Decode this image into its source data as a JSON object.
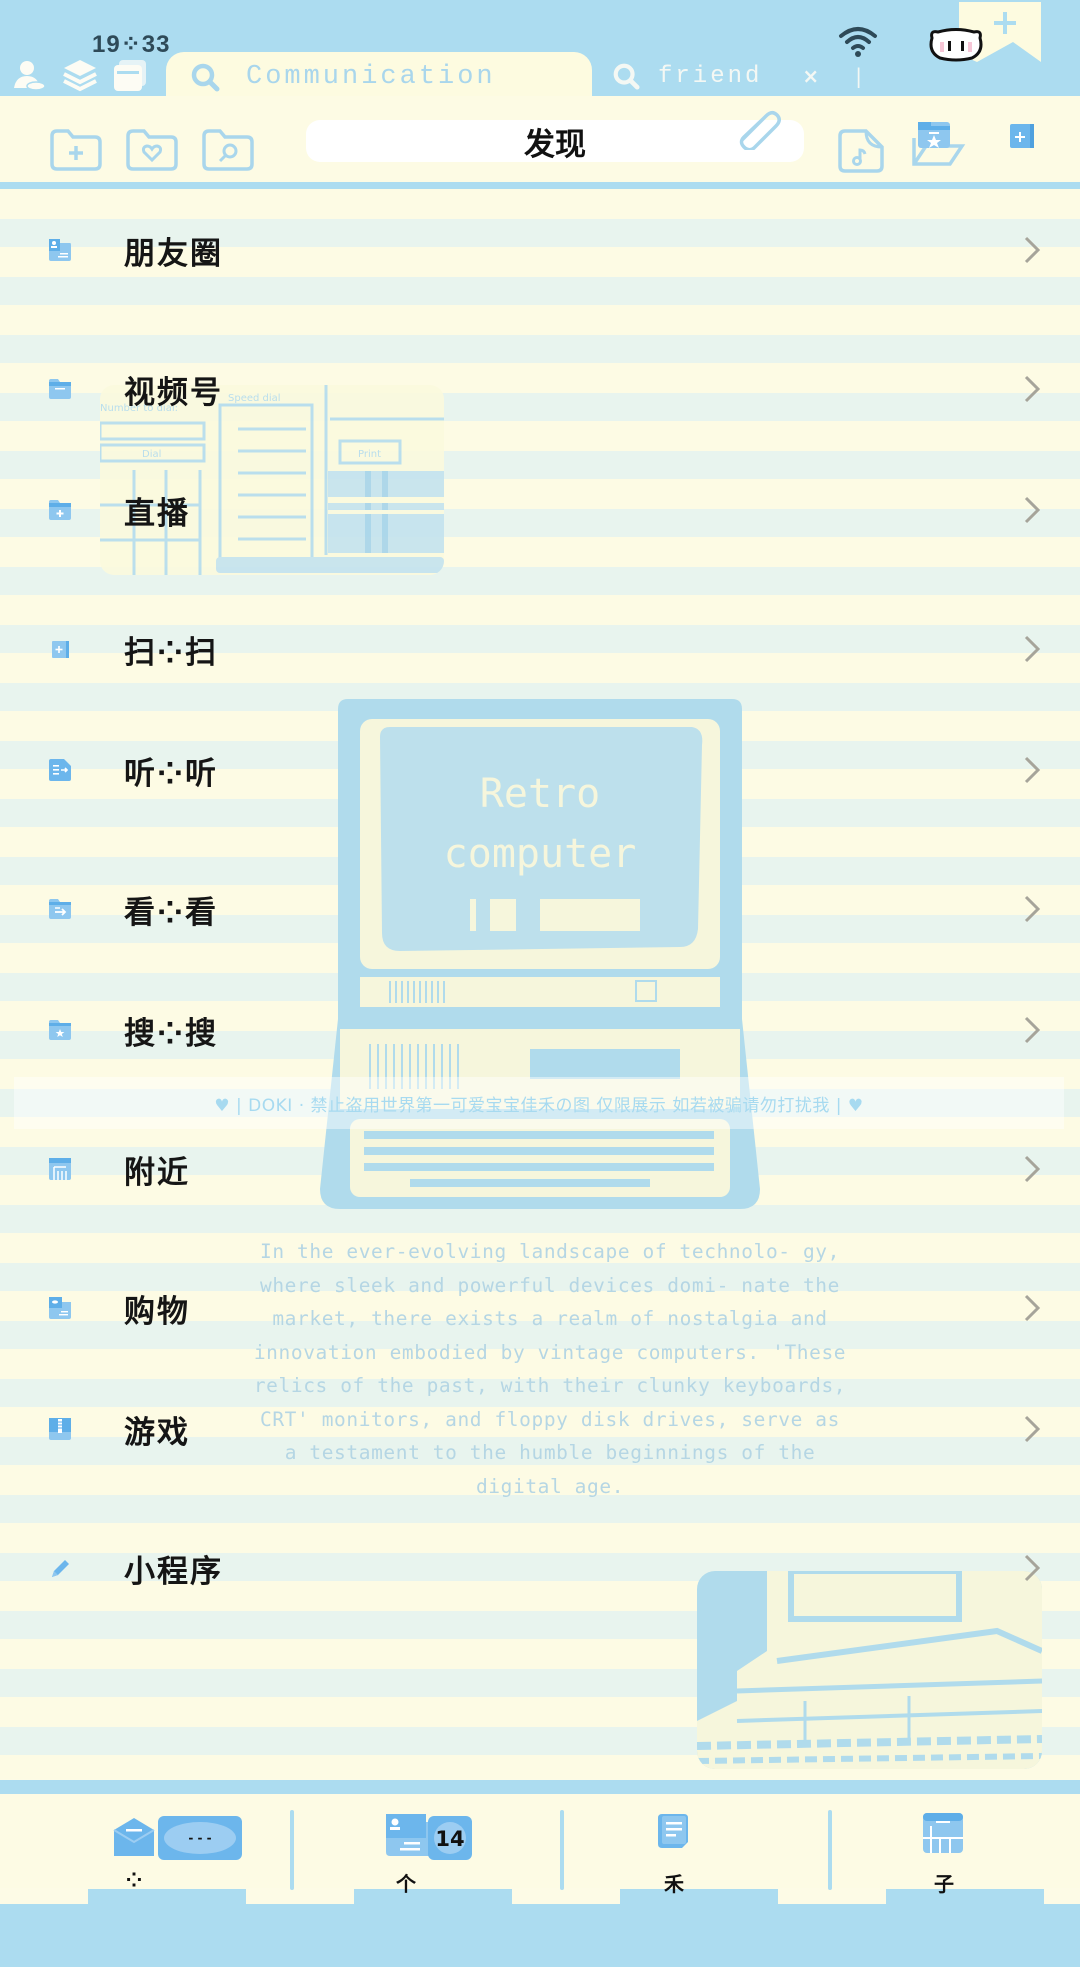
{
  "status_bar": {
    "time": "19⁘33",
    "wifi_icon": "wifi-icon",
    "mascot_icon": "cat-face-icon"
  },
  "tabs": [
    {
      "label": "Communication",
      "active": true,
      "icon": "search-icon"
    },
    {
      "label": "friend",
      "active": false,
      "icon": "search-icon",
      "close": "×",
      "cursor": "|"
    }
  ],
  "toolbar": {
    "title": "发现",
    "left_icons": [
      "folder-add-icon",
      "folder-heart-icon",
      "folder-search-icon"
    ],
    "right_icons": [
      "paperclip-icon",
      "music-file-icon",
      "star-folder-icon",
      "add-square-icon"
    ],
    "new_tab_button": "+"
  },
  "menu": {
    "items": [
      {
        "label": "朋友圈",
        "icon": "contact-folder-icon"
      },
      {
        "label": "视频号",
        "icon": "folder-icon"
      },
      {
        "label": "直播",
        "icon": "folder-plus-icon"
      },
      {
        "label": "扫⁘扫",
        "icon": "square-plus-icon"
      },
      {
        "label": "听⁘听",
        "icon": "document-arrow-icon"
      },
      {
        "label": "看⁘看",
        "icon": "folder-arrow-icon"
      },
      {
        "label": "搜⁘搜",
        "icon": "folder-star-icon"
      },
      {
        "label": "附近",
        "icon": "building-icon"
      },
      {
        "label": "购物",
        "icon": "card-icon"
      },
      {
        "label": "游戏",
        "icon": "zipper-icon"
      },
      {
        "label": "小程序",
        "icon": "pencil-icon"
      }
    ]
  },
  "decor": {
    "screen_text_line1": "Retro",
    "screen_text_line2": "computer",
    "watermark": "♥ | DOKI · 禁止盗用世界第一可爱宝宝佳禾の图 仅限展示 如若被骗请勿打扰我 | ♥",
    "paragraph": "In the ever-evolving landscape of technolo- gy, where sleek and powerful devices domi- nate the market, there exists a realm of nostalgia and innovation embodied by vintage computers. 'These relics of the past, with their clunky keyboards, CRT' monitors, and floppy disk drives, serve as a testament to the humble beginnings of the digital age.",
    "dial_labels": [
      "Number to dial:",
      "Dial",
      "Speed dial",
      "Print"
    ]
  },
  "bottom_nav": {
    "items": [
      {
        "label": "⁘",
        "icon": "envelope-icon",
        "badge": "- - -"
      },
      {
        "label": "个",
        "icon": "contact-card-icon",
        "badge": "14"
      },
      {
        "label": "禾",
        "icon": "note-icon"
      },
      {
        "label": "子",
        "icon": "grid-window-icon"
      }
    ]
  },
  "colors": {
    "accent_blue": "#acdcf0",
    "icon_blue": "#6cb6ec",
    "cream": "#fdfbe4",
    "stripe": "#e8f4ee",
    "text": "#151515"
  }
}
